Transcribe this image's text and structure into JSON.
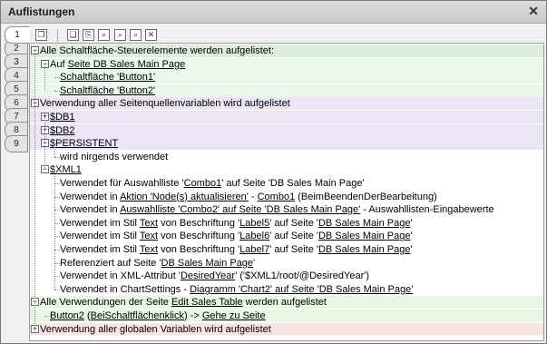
{
  "window": {
    "title": "Auflistungen",
    "close_label": "✕"
  },
  "side_tabs": [
    "1",
    "2",
    "3",
    "4",
    "5",
    "6",
    "7",
    "8",
    "9"
  ],
  "toolbar": {
    "buttons": [
      "copy-icon",
      "copy-all-icon",
      "paste-icon",
      "find-icon",
      "find-next-icon",
      "find-prev-icon",
      "delete-icon"
    ]
  },
  "tree": [
    {
      "type": "section",
      "exp": "−",
      "parts": [
        {
          "t": "Alle Schaltfläche-Steuerelemente werden aufgelistet:"
        }
      ]
    },
    {
      "type": "node",
      "exp": "−",
      "parts": [
        {
          "t": "Auf "
        },
        {
          "t": "Seite DB Sales Main Page",
          "u": true
        }
      ]
    },
    {
      "type": "leaf",
      "parts": [
        {
          "t": "Schaltfläche 'Button1'",
          "u": true
        }
      ]
    },
    {
      "type": "leaf",
      "parts": [
        {
          "t": "Schaltfläche 'Button2'",
          "u": true
        }
      ]
    },
    {
      "type": "section",
      "exp": "−",
      "parts": [
        {
          "t": "Verwendung aller Seitenquellenvariablen wird aufgelistet"
        }
      ]
    },
    {
      "type": "node",
      "exp": "+",
      "parts": [
        {
          "t": "$DB1",
          "u": true
        }
      ]
    },
    {
      "type": "node",
      "exp": "+",
      "parts": [
        {
          "t": "$DB2",
          "u": true
        }
      ]
    },
    {
      "type": "node",
      "exp": "−",
      "parts": [
        {
          "t": "$PERSISTENT",
          "u": true
        }
      ]
    },
    {
      "type": "leaf",
      "parts": [
        {
          "t": "wird nirgends verwendet"
        }
      ]
    },
    {
      "type": "node",
      "exp": "−",
      "parts": [
        {
          "t": "$XML1",
          "u": true
        }
      ]
    },
    {
      "type": "leaf",
      "parts": [
        {
          "t": "Verwendet für Auswahlliste '"
        },
        {
          "t": "Combo1",
          "u": true
        },
        {
          "t": "' auf Seite 'DB Sales Main Page'"
        }
      ]
    },
    {
      "type": "leaf",
      "parts": [
        {
          "t": "Verwendet in "
        },
        {
          "t": "Aktion 'Node(s) aktualisieren'",
          "u": true
        },
        {
          "t": " - "
        },
        {
          "t": "Combo1",
          "u": true
        },
        {
          "t": " (BeimBeendenDerBearbeitung)"
        }
      ]
    },
    {
      "type": "leaf",
      "parts": [
        {
          "t": "Verwendet in "
        },
        {
          "t": "Auswahlliste 'Combo2' auf Seite 'DB Sales Main Page'",
          "u": true
        },
        {
          "t": " - Auswahllisten-Eingabewerte"
        }
      ]
    },
    {
      "type": "leaf",
      "parts": [
        {
          "t": "Verwendet im Stil "
        },
        {
          "t": "Text",
          "u": true
        },
        {
          "t": " von Beschriftung '"
        },
        {
          "t": "Label5",
          "u": true
        },
        {
          "t": "' auf Seite '"
        },
        {
          "t": "DB Sales Main Page",
          "u": true
        },
        {
          "t": "'"
        }
      ]
    },
    {
      "type": "leaf",
      "parts": [
        {
          "t": "Verwendet im Stil "
        },
        {
          "t": "Text",
          "u": true
        },
        {
          "t": " von Beschriftung '"
        },
        {
          "t": "Label6",
          "u": true
        },
        {
          "t": "' auf Seite '"
        },
        {
          "t": "DB Sales Main Page",
          "u": true
        },
        {
          "t": "'"
        }
      ]
    },
    {
      "type": "leaf",
      "parts": [
        {
          "t": "Verwendet im Stil "
        },
        {
          "t": "Text",
          "u": true
        },
        {
          "t": " von Beschriftung '"
        },
        {
          "t": "Label7",
          "u": true
        },
        {
          "t": "' auf Seite '"
        },
        {
          "t": "DB Sales Main Page",
          "u": true
        },
        {
          "t": "'"
        }
      ]
    },
    {
      "type": "leaf",
      "parts": [
        {
          "t": "Referenziert auf Seite '"
        },
        {
          "t": "DB Sales Main Page",
          "u": true
        },
        {
          "t": "'"
        }
      ]
    },
    {
      "type": "leaf",
      "parts": [
        {
          "t": "Verwendet in XML-Attribut '"
        },
        {
          "t": "DesiredYear",
          "u": true
        },
        {
          "t": "' ('$XML1/root/@DesiredYear')"
        }
      ]
    },
    {
      "type": "leaf",
      "parts": [
        {
          "t": "Verwendet in ChartSettings - "
        },
        {
          "t": "Diagramm 'Chart2' auf Seite 'DB Sales Main Page'",
          "u": true
        }
      ]
    },
    {
      "type": "section",
      "exp": "−",
      "parts": [
        {
          "t": "Alle Verwendungen der Seite "
        },
        {
          "t": "Edit Sales Table",
          "u": true
        },
        {
          "t": " werden aufgelistet"
        }
      ]
    },
    {
      "type": "leaf",
      "parts": [
        {
          "t": "Button2",
          "u": true
        },
        {
          "t": " ("
        },
        {
          "t": "BeiSchaltflächenklick",
          "u": true
        },
        {
          "t": ") -> "
        },
        {
          "t": "Gehe zu Seite",
          "u": true
        }
      ]
    },
    {
      "type": "section",
      "exp": "+",
      "parts": [
        {
          "t": "Verwendung aller globalen Variablen wird aufgelistet"
        }
      ]
    }
  ],
  "colors": {
    "section_1": "#ddeedd",
    "section_1_body": "#e9f8ea",
    "section_2": "#ece5f5",
    "section_3": "#e9f6e3",
    "section_4": "#f8e4e4"
  }
}
